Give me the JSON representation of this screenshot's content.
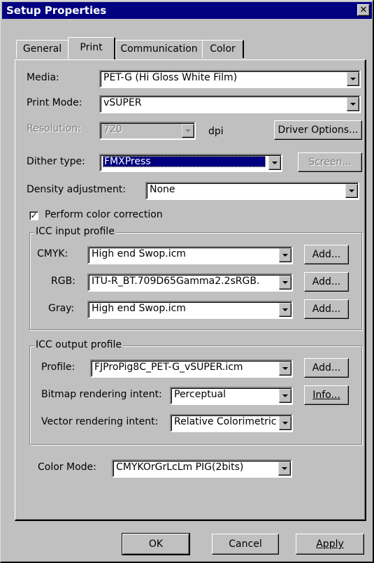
{
  "window": {
    "title": "Setup Properties",
    "close_glyph": "✕"
  },
  "tabs": [
    "General",
    "Print",
    "Communication",
    "Color"
  ],
  "active_tab": "Print",
  "print": {
    "media_label": "Media:",
    "media_value": "PET-G (Hi Gloss White Film)",
    "print_mode_label": "Print Mode:",
    "print_mode_value": "vSUPER",
    "resolution_label": "Resolution:",
    "resolution_value": "720",
    "resolution_unit": "dpi",
    "driver_options_label": "Driver Options...",
    "dither_label": "Dither type:",
    "dither_value": "FMXPress",
    "screen_label": "Screen...",
    "density_label": "Density adjustment:",
    "density_value": "None",
    "color_correction_label": "Perform color correction",
    "color_correction_checked": true,
    "icc_input": {
      "title": "ICC input profile",
      "cmyk_label": "CMYK:",
      "cmyk_value": "High end Swop.icm",
      "rgb_label": "RGB:",
      "rgb_value": "ITU-R_BT.709D65Gamma2.2sRGB.",
      "gray_label": "Gray:",
      "gray_value": "High end Swop.icm",
      "add_label": "Add..."
    },
    "icc_output": {
      "title": "ICC output profile",
      "profile_label": "Profile:",
      "profile_value": "FJProPig8C_PET-G_vSUPER.icm",
      "add_label": "Add...",
      "bitmap_label": "Bitmap rendering intent:",
      "bitmap_value": "Perceptual",
      "info_label": "Info...",
      "vector_label": "Vector rendering intent:",
      "vector_value": "Relative Colorimetric"
    },
    "color_mode_label": "Color Mode:",
    "color_mode_value": "CMYKOrGrLcLm PIG(2bits)"
  },
  "footer": {
    "ok_label": "OK",
    "cancel_label": "Cancel",
    "apply_label": "Apply"
  },
  "colors": {
    "face": "#c0c0c0",
    "title_bar": "#000080",
    "selection": "#000080"
  }
}
